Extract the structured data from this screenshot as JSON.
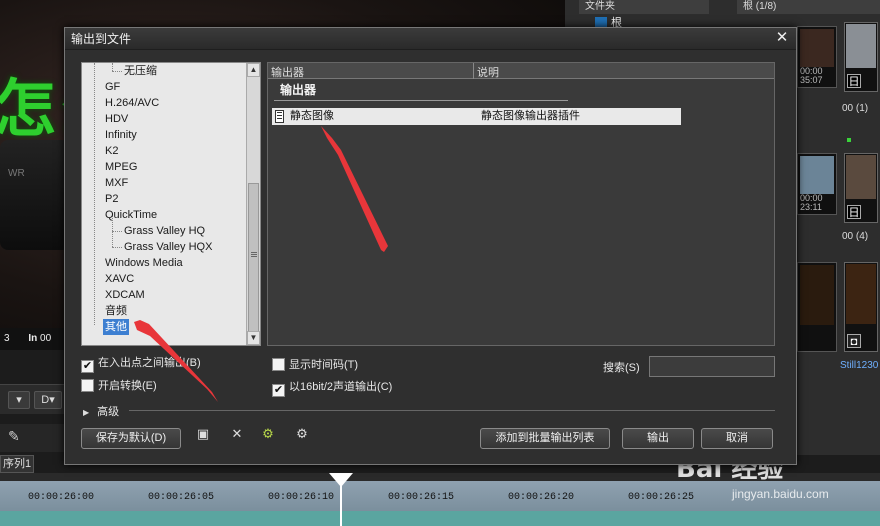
{
  "background": {
    "preview_text": "怎么",
    "device_label": "WR",
    "status_tc": "3",
    "status_in": "In",
    "status_in_value": "00",
    "timeline_tab": "序列1",
    "bin_header": "文件夹",
    "bin_root": "根",
    "bin_title": "根 (1/8)",
    "thumb_labels": [
      "00:00",
      "35:07",
      "00:00",
      "23:11",
      "",
      ""
    ],
    "counts": [
      "00 (1)",
      "00 (4)"
    ],
    "still_label": "Still1230",
    "thumb_tag": "日",
    "timecodes": [
      "00:00:26:00",
      "00:00:26:05",
      "00:00:26:10",
      "00:00:26:15",
      "00:00:26:20",
      "00:00:26:25"
    ],
    "watermark": "Bai 经验",
    "watermark_sub": "jingyan.baidu.com"
  },
  "dialog": {
    "title": "输出到文件",
    "close_label": "✕",
    "tree": {
      "items": [
        {
          "label": "无压缩",
          "level": 2
        },
        {
          "label": "GF",
          "level": 1
        },
        {
          "label": "H.264/AVC",
          "level": 1
        },
        {
          "label": "HDV",
          "level": 1
        },
        {
          "label": "Infinity",
          "level": 1
        },
        {
          "label": "K2",
          "level": 1
        },
        {
          "label": "MPEG",
          "level": 1
        },
        {
          "label": "MXF",
          "level": 1
        },
        {
          "label": "P2",
          "level": 1
        },
        {
          "label": "QuickTime",
          "level": 1
        },
        {
          "label": "Grass Valley HQ",
          "level": 2
        },
        {
          "label": "Grass Valley HQX",
          "level": 2
        },
        {
          "label": "Windows Media",
          "level": 1
        },
        {
          "label": "XAVC",
          "level": 1
        },
        {
          "label": "XDCAM",
          "level": 1
        },
        {
          "label": "音频",
          "level": 1
        },
        {
          "label": "其他",
          "level": 1,
          "selected": true
        }
      ]
    },
    "list": {
      "col_exporter": "输出器",
      "col_description": "说明",
      "group": "输出器",
      "rows": [
        {
          "name": "静态图像",
          "description": "静态图像输出器插件"
        }
      ]
    },
    "options": {
      "export_between_inout": {
        "label": "在入出点之间输出(B)",
        "checked": true
      },
      "enable_conversion": {
        "label": "开启转换(E)",
        "checked": false
      },
      "show_timecode": {
        "label": "显示时间码(T)",
        "checked": false
      },
      "export_16bit": {
        "label": "以16bit/2声道输出(C)",
        "checked": true
      }
    },
    "search_label": "搜索(S)",
    "search_value": "",
    "advanced_label": "高级",
    "buttons": {
      "save_default": "保存为默认(D)",
      "add_batch": "添加到批量输出列表",
      "export": "输出",
      "cancel": "取消"
    },
    "accent_colors": {
      "selection": "#3d7fd1",
      "annotation_arrow": "#e8363a"
    }
  }
}
